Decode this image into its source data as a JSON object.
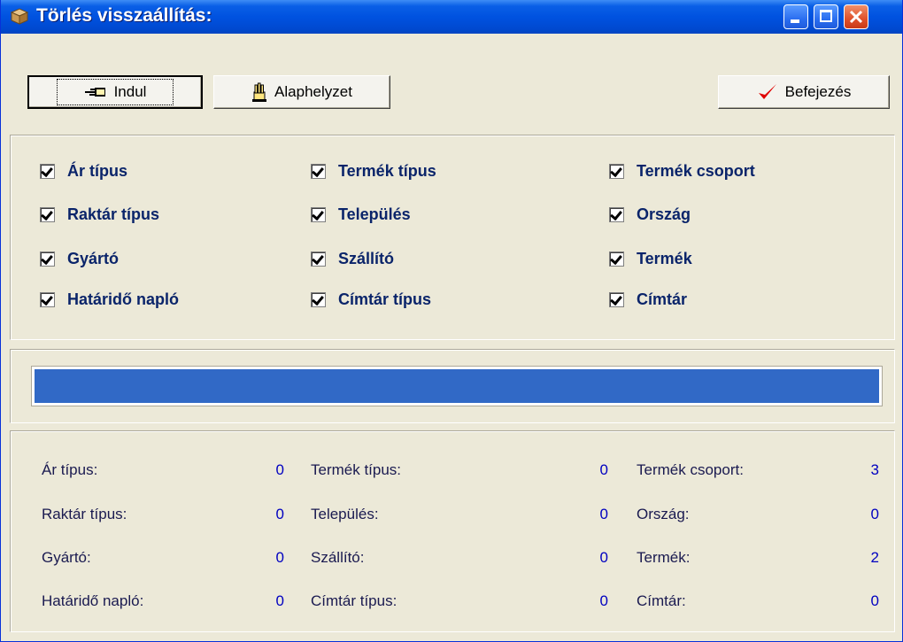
{
  "window": {
    "title": "Törlés visszaállítás:",
    "close_color": "#E0502A",
    "accent": "#0052E0"
  },
  "toolbar": {
    "start_label": "Indul",
    "reset_label": "Alaphelyzet",
    "finish_label": "Befejezés"
  },
  "options": [
    {
      "label": "Ár típus",
      "checked": true
    },
    {
      "label": "Termék típus",
      "checked": true
    },
    {
      "label": "Termék csoport",
      "checked": true
    },
    {
      "label": "Raktár típus",
      "checked": true
    },
    {
      "label": "Település",
      "checked": true
    },
    {
      "label": "Ország",
      "checked": true
    },
    {
      "label": "Gyártó",
      "checked": true
    },
    {
      "label": "Szállító",
      "checked": true
    },
    {
      "label": "Termék",
      "checked": true
    },
    {
      "label": "Határidő napló",
      "checked": true
    },
    {
      "label": "Címtár típus",
      "checked": true
    },
    {
      "label": "Címtár",
      "checked": true
    }
  ],
  "progress": {
    "value": 1.0,
    "color": "#3169C6"
  },
  "stats": [
    {
      "label": "Ár típus:",
      "value": "0"
    },
    {
      "label": "Termék típus:",
      "value": "0"
    },
    {
      "label": "Termék csoport:",
      "value": "3"
    },
    {
      "label": "Raktár típus:",
      "value": "0"
    },
    {
      "label": "Település:",
      "value": "0"
    },
    {
      "label": "Ország:",
      "value": "0"
    },
    {
      "label": "Gyártó:",
      "value": "0"
    },
    {
      "label": "Szállító:",
      "value": "0"
    },
    {
      "label": "Termék:",
      "value": "2"
    },
    {
      "label": "Határidő napló:",
      "value": "0"
    },
    {
      "label": "Címtár típus:",
      "value": "0"
    },
    {
      "label": "Címtár:",
      "value": "0"
    }
  ]
}
